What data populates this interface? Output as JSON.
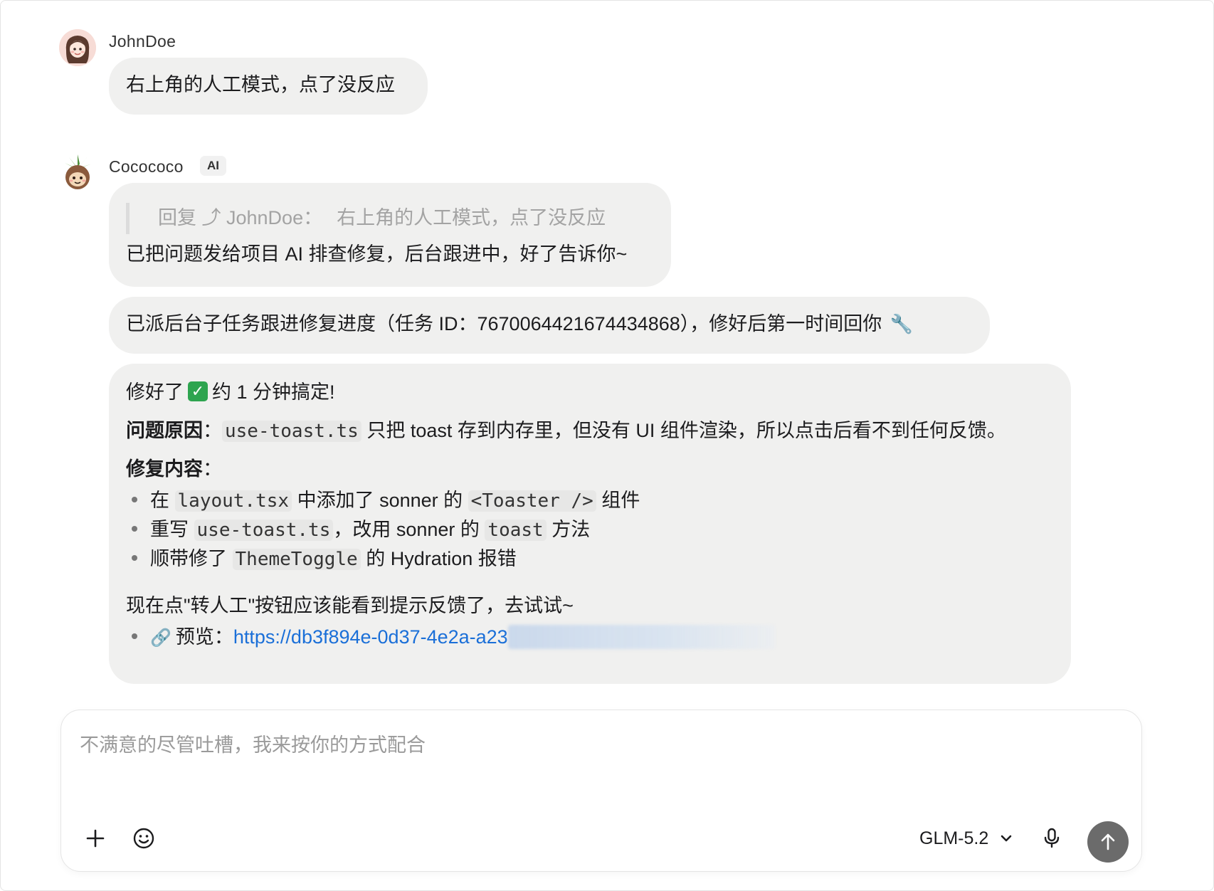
{
  "messages": {
    "user": {
      "name": "JohnDoe",
      "text": "右上角的人工模式，点了没反应"
    },
    "ai": {
      "name": "Cocococo",
      "badge": "AI",
      "reply": {
        "quote_prefix": "回复 ⤴ JohnDoe：",
        "quote_text": "右上角的人工模式，点了没反应",
        "text": "已把问题发给项目 AI 排查修复，后台跟进中，好了告诉你~"
      },
      "status": {
        "text": "已派后台子任务跟进修复进度（任务 ID：7670064421674434868），修好后第一时间回你",
        "icon": "wrench-icon",
        "icon_glyph": "🔧"
      },
      "fix": {
        "line1_pre": "修好了",
        "line1_check": "✓",
        "line1_post": "约 1 分钟搞定!",
        "cause_label": "问题原因",
        "cause_colon": "：",
        "cause_code": "use-toast.ts",
        "cause_text": " 只把 toast 存到内存里，但没有 UI 组件渲染，所以点击后看不到任何反馈。",
        "content_label": "修复内容",
        "content_colon": "：",
        "items": [
          {
            "pre": "在 ",
            "code1": "layout.tsx",
            "mid": " 中添加了 sonner 的 ",
            "code2": "<Toaster />",
            "post": " 组件"
          },
          {
            "pre": "重写 ",
            "code1": "use-toast.ts",
            "mid": "，改用 sonner 的 ",
            "code2": "toast",
            "post": " 方法"
          },
          {
            "pre": "顺带修了 ",
            "code1": "ThemeToggle",
            "mid": " 的 Hydration 报错",
            "code2": "",
            "post": ""
          }
        ],
        "closing": "现在点\"转人工\"按钮应该能看到提示反馈了，去试试~",
        "preview_icon": "🔗",
        "preview_label": "预览：",
        "preview_url": "https://db3f894e-0d37-4e2a-a23"
      }
    }
  },
  "composer": {
    "placeholder": "不满意的尽管吐槽，我来按你的方式配合",
    "value": "",
    "model": "GLM-5.2"
  },
  "colors": {
    "bubble": "#f0f0ef",
    "link": "#1a6fd8",
    "send": "#6b6b6b",
    "check": "#2ea44f"
  }
}
